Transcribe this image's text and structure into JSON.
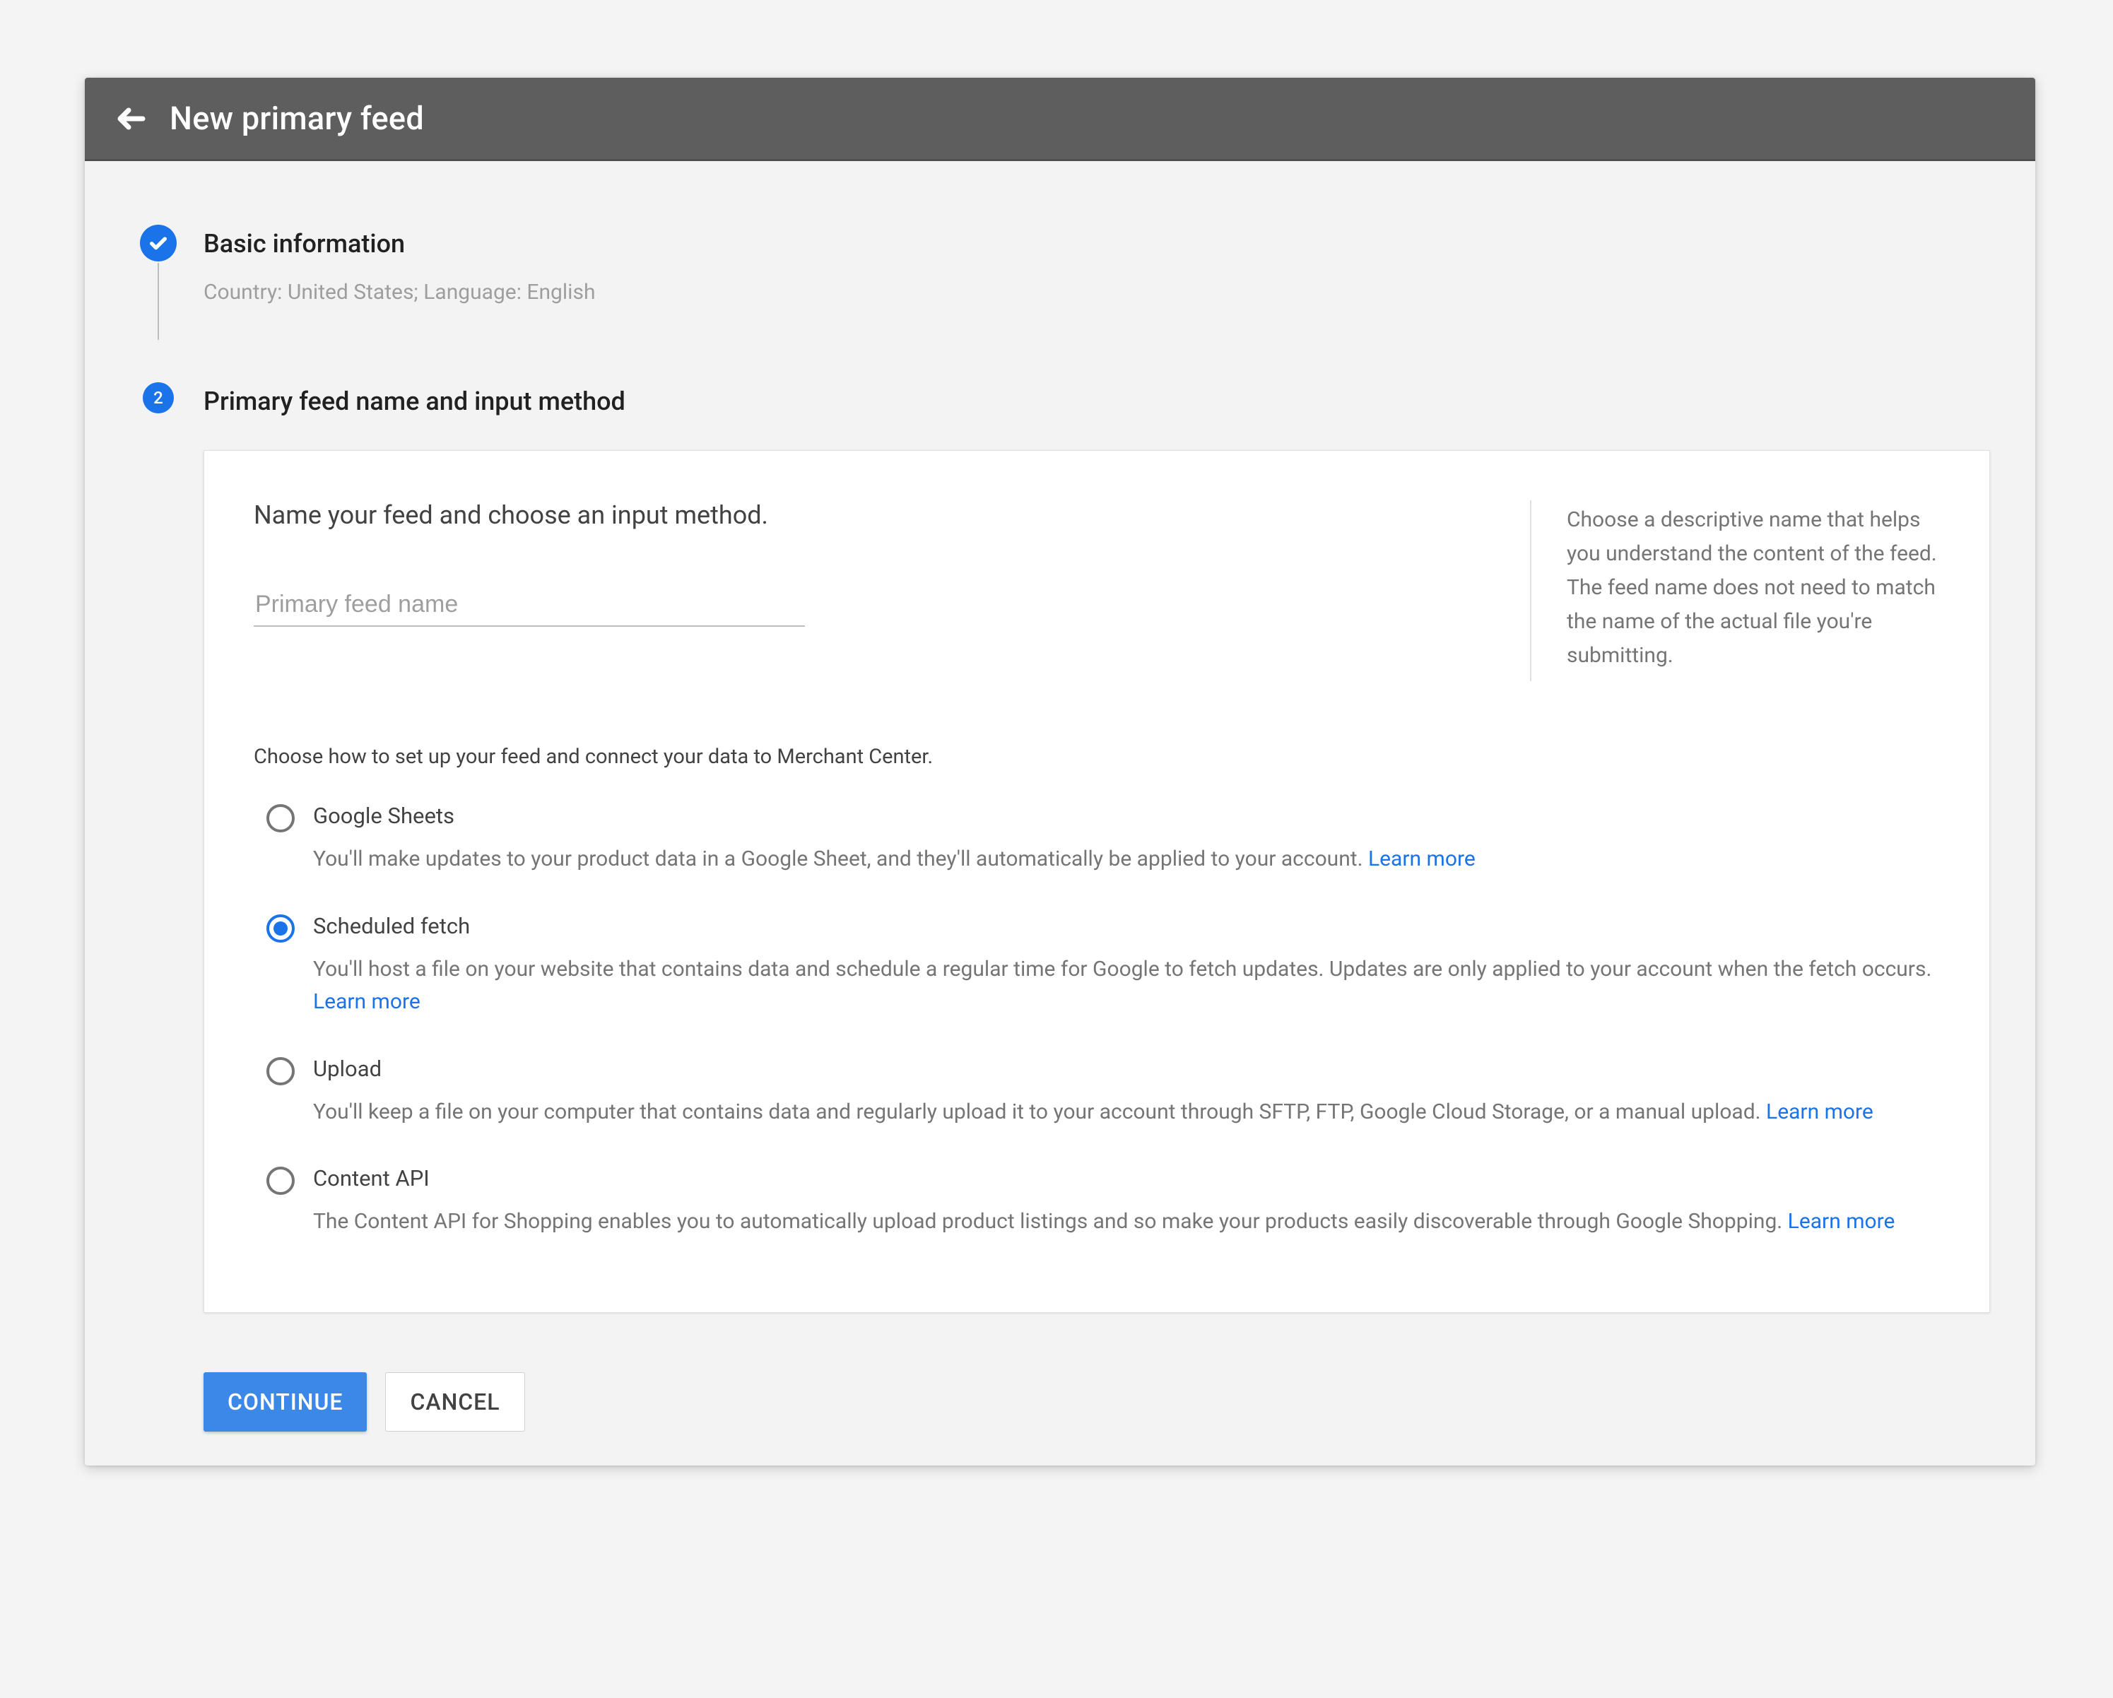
{
  "header": {
    "title": "New primary feed"
  },
  "step1": {
    "title": "Basic information",
    "subtitle": "Country: United States; Language: English"
  },
  "step2": {
    "number": "2",
    "title": "Primary feed name and input method",
    "heading": "Name your feed and choose an input method.",
    "help": "Choose a descriptive name that helps you understand the content of the feed. The feed name does not need to match the name of the actual file you're submitting.",
    "placeholder": "Primary feed name",
    "value": "",
    "choose": "Choose how to set up your feed and connect your data to Merchant Center.",
    "options": [
      {
        "label": "Google Sheets",
        "desc": "You'll make updates to your product data in a Google Sheet, and they'll automatically be applied to your account. ",
        "learn": "Learn more"
      },
      {
        "label": "Scheduled fetch",
        "desc": "You'll host a file on your website that contains data and schedule a regular time for Google to fetch updates. Updates are only applied to your account when the fetch occurs. ",
        "learn": "Learn more"
      },
      {
        "label": "Upload",
        "desc": "You'll keep a file on your computer that contains data and regularly upload it to your account through SFTP, FTP, Google Cloud Storage, or a manual upload. ",
        "learn": "Learn more"
      },
      {
        "label": "Content API",
        "desc": "The Content API for Shopping enables you to automatically upload product listings and so make your products easily discoverable through Google Shopping. ",
        "learn": "Learn more"
      }
    ],
    "selected": 1
  },
  "footer": {
    "continue": "CONTINUE",
    "cancel": "CANCEL"
  }
}
